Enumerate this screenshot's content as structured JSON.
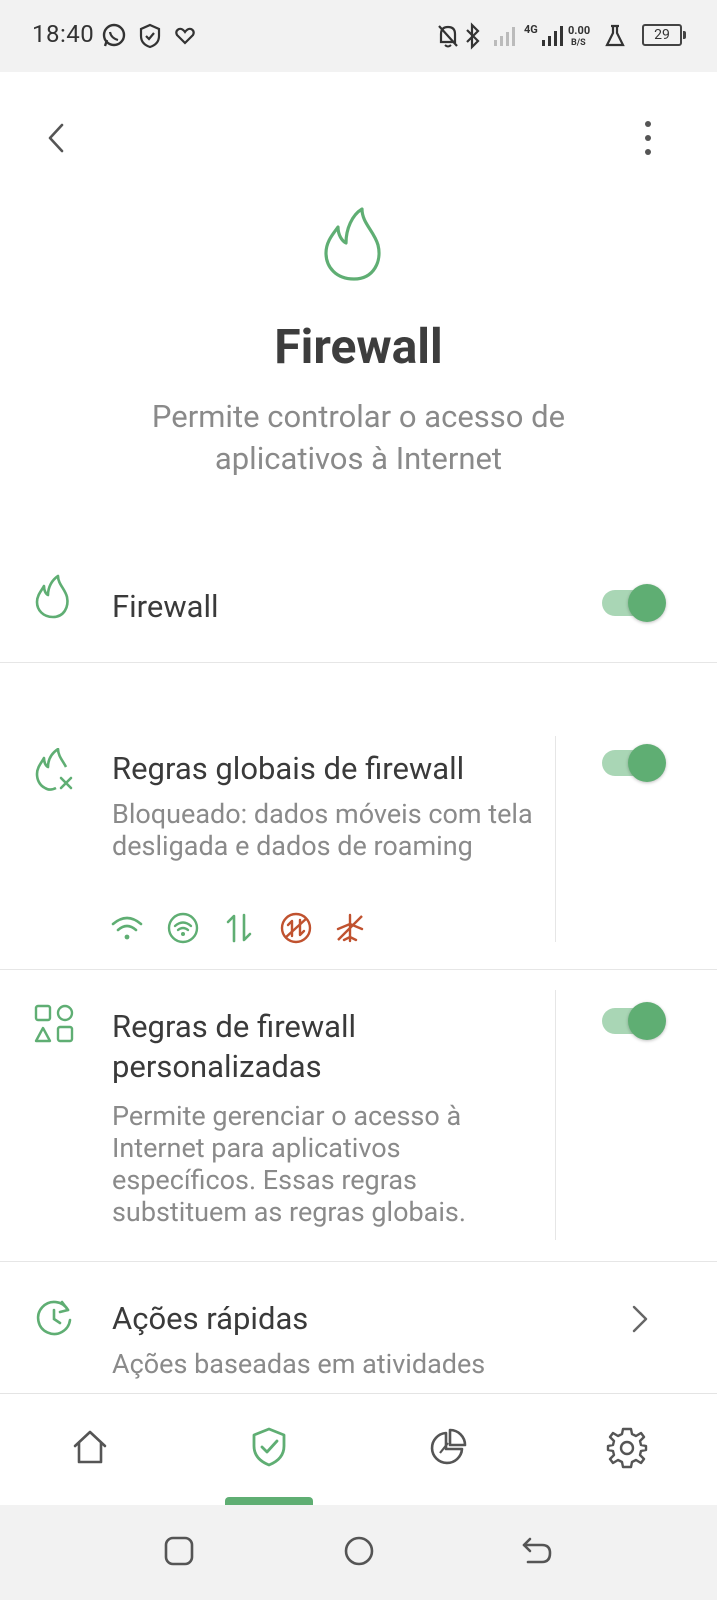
{
  "status_bar": {
    "time": "18:40",
    "network_type": "4G",
    "speed_value": "0.00",
    "speed_unit": "B/S",
    "battery": "29",
    "icons": [
      "whatsapp-icon",
      "shield-check-icon",
      "heart-link-icon",
      "bell-off-icon",
      "bluetooth-icon",
      "signal-icon",
      "signal-4g-icon",
      "flask-icon",
      "battery-icon"
    ]
  },
  "top_bar": {
    "back_icon": "chevron-left-icon",
    "menu_icon": "more-vertical-icon"
  },
  "header": {
    "icon": "flame-icon",
    "title": "Firewall",
    "subtitle": "Permite controlar o acesso de aplicativos à Internet"
  },
  "settings": {
    "firewall": {
      "icon": "flame-icon",
      "title": "Firewall",
      "enabled": true
    },
    "global_rules": {
      "icon": "flame-x-icon",
      "title": "Regras globais de firewall",
      "description": "Bloqueado: dados móveis com tela desligada e dados de roaming",
      "enabled": true,
      "modes": [
        {
          "icon": "wifi-icon",
          "blocked": false
        },
        {
          "icon": "wifi-circle-icon",
          "blocked": false
        },
        {
          "icon": "mobile-data-icon",
          "blocked": false
        },
        {
          "icon": "mobile-data-screen-off-icon",
          "blocked": true
        },
        {
          "icon": "airplane-roaming-icon",
          "blocked": true
        }
      ]
    },
    "custom_rules": {
      "icon": "shapes-icon",
      "title_line1": "Regras de firewall",
      "title_line2": "personalizadas",
      "description": "Permite gerenciar o acesso à Internet para aplicativos específicos. Essas regras substituem as regras globais.",
      "enabled": true
    },
    "quick_actions": {
      "icon": "clock-refresh-icon",
      "title": "Ações rápidas",
      "description": "Ações baseadas em atividades"
    }
  },
  "bottom_nav": {
    "items": [
      {
        "icon": "home-icon",
        "active": false
      },
      {
        "icon": "shield-check-icon",
        "active": true
      },
      {
        "icon": "pie-chart-icon",
        "active": false
      },
      {
        "icon": "gear-icon",
        "active": false
      }
    ]
  },
  "colors": {
    "accent": "#5fae73",
    "accent_light": "#a9d6b5",
    "blocked": "#c0522f",
    "text_primary": "#3a3a3a",
    "text_secondary": "#8a8a8a"
  }
}
